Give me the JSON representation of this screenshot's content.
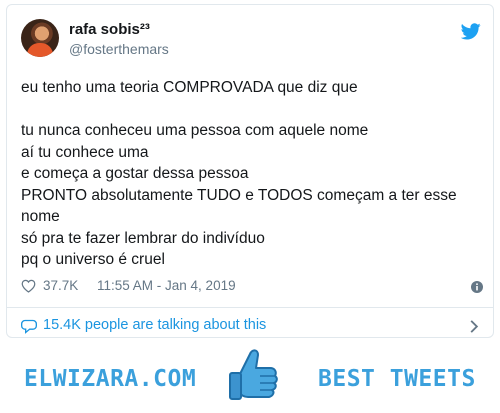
{
  "tweet": {
    "author": {
      "display_name": "rafa sobis²³",
      "handle": "@fosterthemars",
      "avatar_icon": "avatar"
    },
    "text": "eu tenho uma teoria COMPROVADA que diz que\n\ntu nunca conheceu uma pessoa com aquele nome\naí tu conhece uma\ne começa a gostar dessa pessoa\nPRONTO absolutamente TUDO e TODOS começam a ter esse nome\nsó pra te fazer lembrar do indivíduo\npq o universo é cruel",
    "likes": "37.7K",
    "timestamp": "11:55 AM - Jan 4, 2019",
    "talking_about": "15.4K people are talking about this"
  },
  "footer": {
    "brand_left": "ELWIZARA.COM",
    "brand_right": "BEST TWEETS"
  },
  "colors": {
    "twitter_blue": "#1da1f2",
    "link_blue": "#1b95e0",
    "muted": "#657786",
    "brand": "#3ba0dc"
  }
}
